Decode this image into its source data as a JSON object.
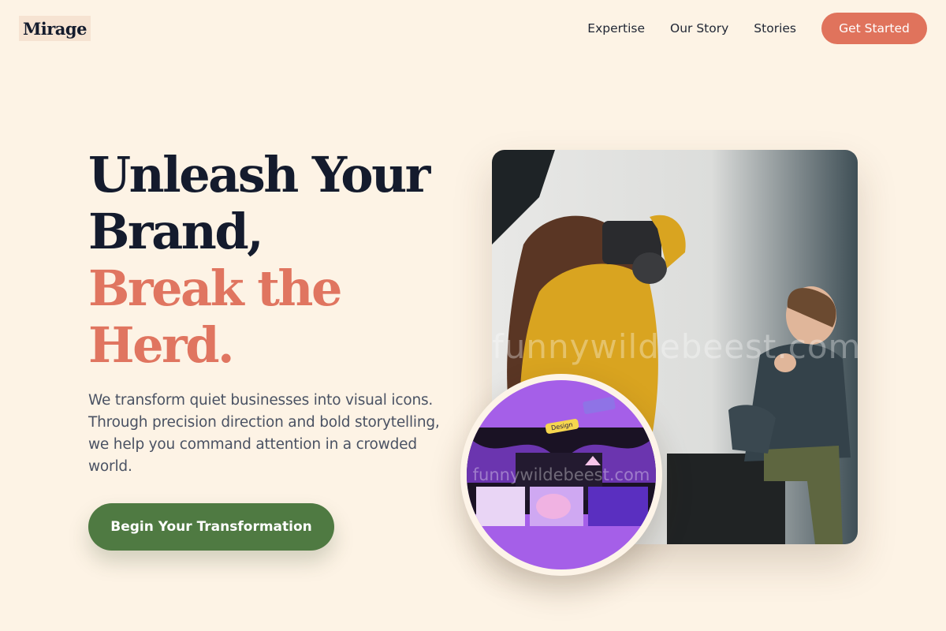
{
  "header": {
    "logo": "Mirage",
    "nav": [
      "Expertise",
      "Our Story",
      "Stories"
    ],
    "cta": "Get Started"
  },
  "hero": {
    "title_line1": "Unleash Your",
    "title_line2": "Brand,",
    "accent_line1": "Break the",
    "accent_line2": "Herd.",
    "description": "We transform quiet businesses into visual icons. Through precision direction and bold storytelling, we help you command attention in a crowded world.",
    "cta": "Begin Your Transformation"
  },
  "media": {
    "watermark": "funnywildebeest.com",
    "inset_tag": "Design"
  },
  "colors": {
    "background": "#fdf3e5",
    "heading": "#141b2d",
    "accent": "#e07560",
    "primary_button": "#4f7a42",
    "nav_button": "#e0735c",
    "inset_purple": "#a55fe8"
  }
}
